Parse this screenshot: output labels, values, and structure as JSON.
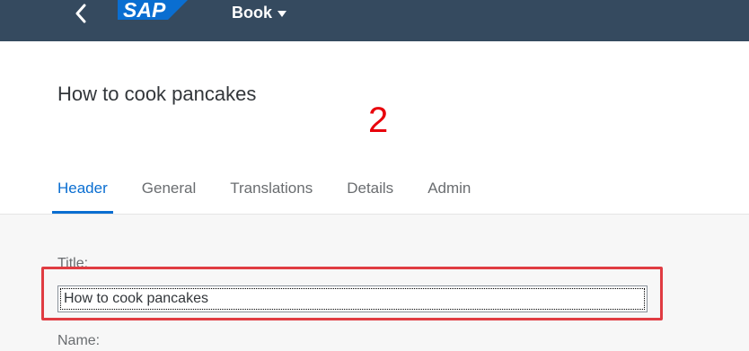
{
  "shell": {
    "logo_text": "SAP",
    "app_title": "Book",
    "brand_color": "#354a5f",
    "logo_color": "#0a6ed1",
    "icons": {
      "back": "chevron-left-icon",
      "menu": "caret-down-icon"
    }
  },
  "object": {
    "title": "How to cook pancakes",
    "step_marker": "2"
  },
  "tabs": [
    {
      "label": "Header",
      "selected": true
    },
    {
      "label": "General",
      "selected": false
    },
    {
      "label": "Translations",
      "selected": false
    },
    {
      "label": "Details",
      "selected": false
    },
    {
      "label": "Admin",
      "selected": false
    }
  ],
  "form": {
    "title_label": "Title:",
    "title_value": "How to cook pancakes",
    "name_label": "Name:"
  },
  "colors": {
    "accent": "#0a6ed1",
    "highlight": "#e03c42",
    "step_marker": "#e8000b"
  }
}
